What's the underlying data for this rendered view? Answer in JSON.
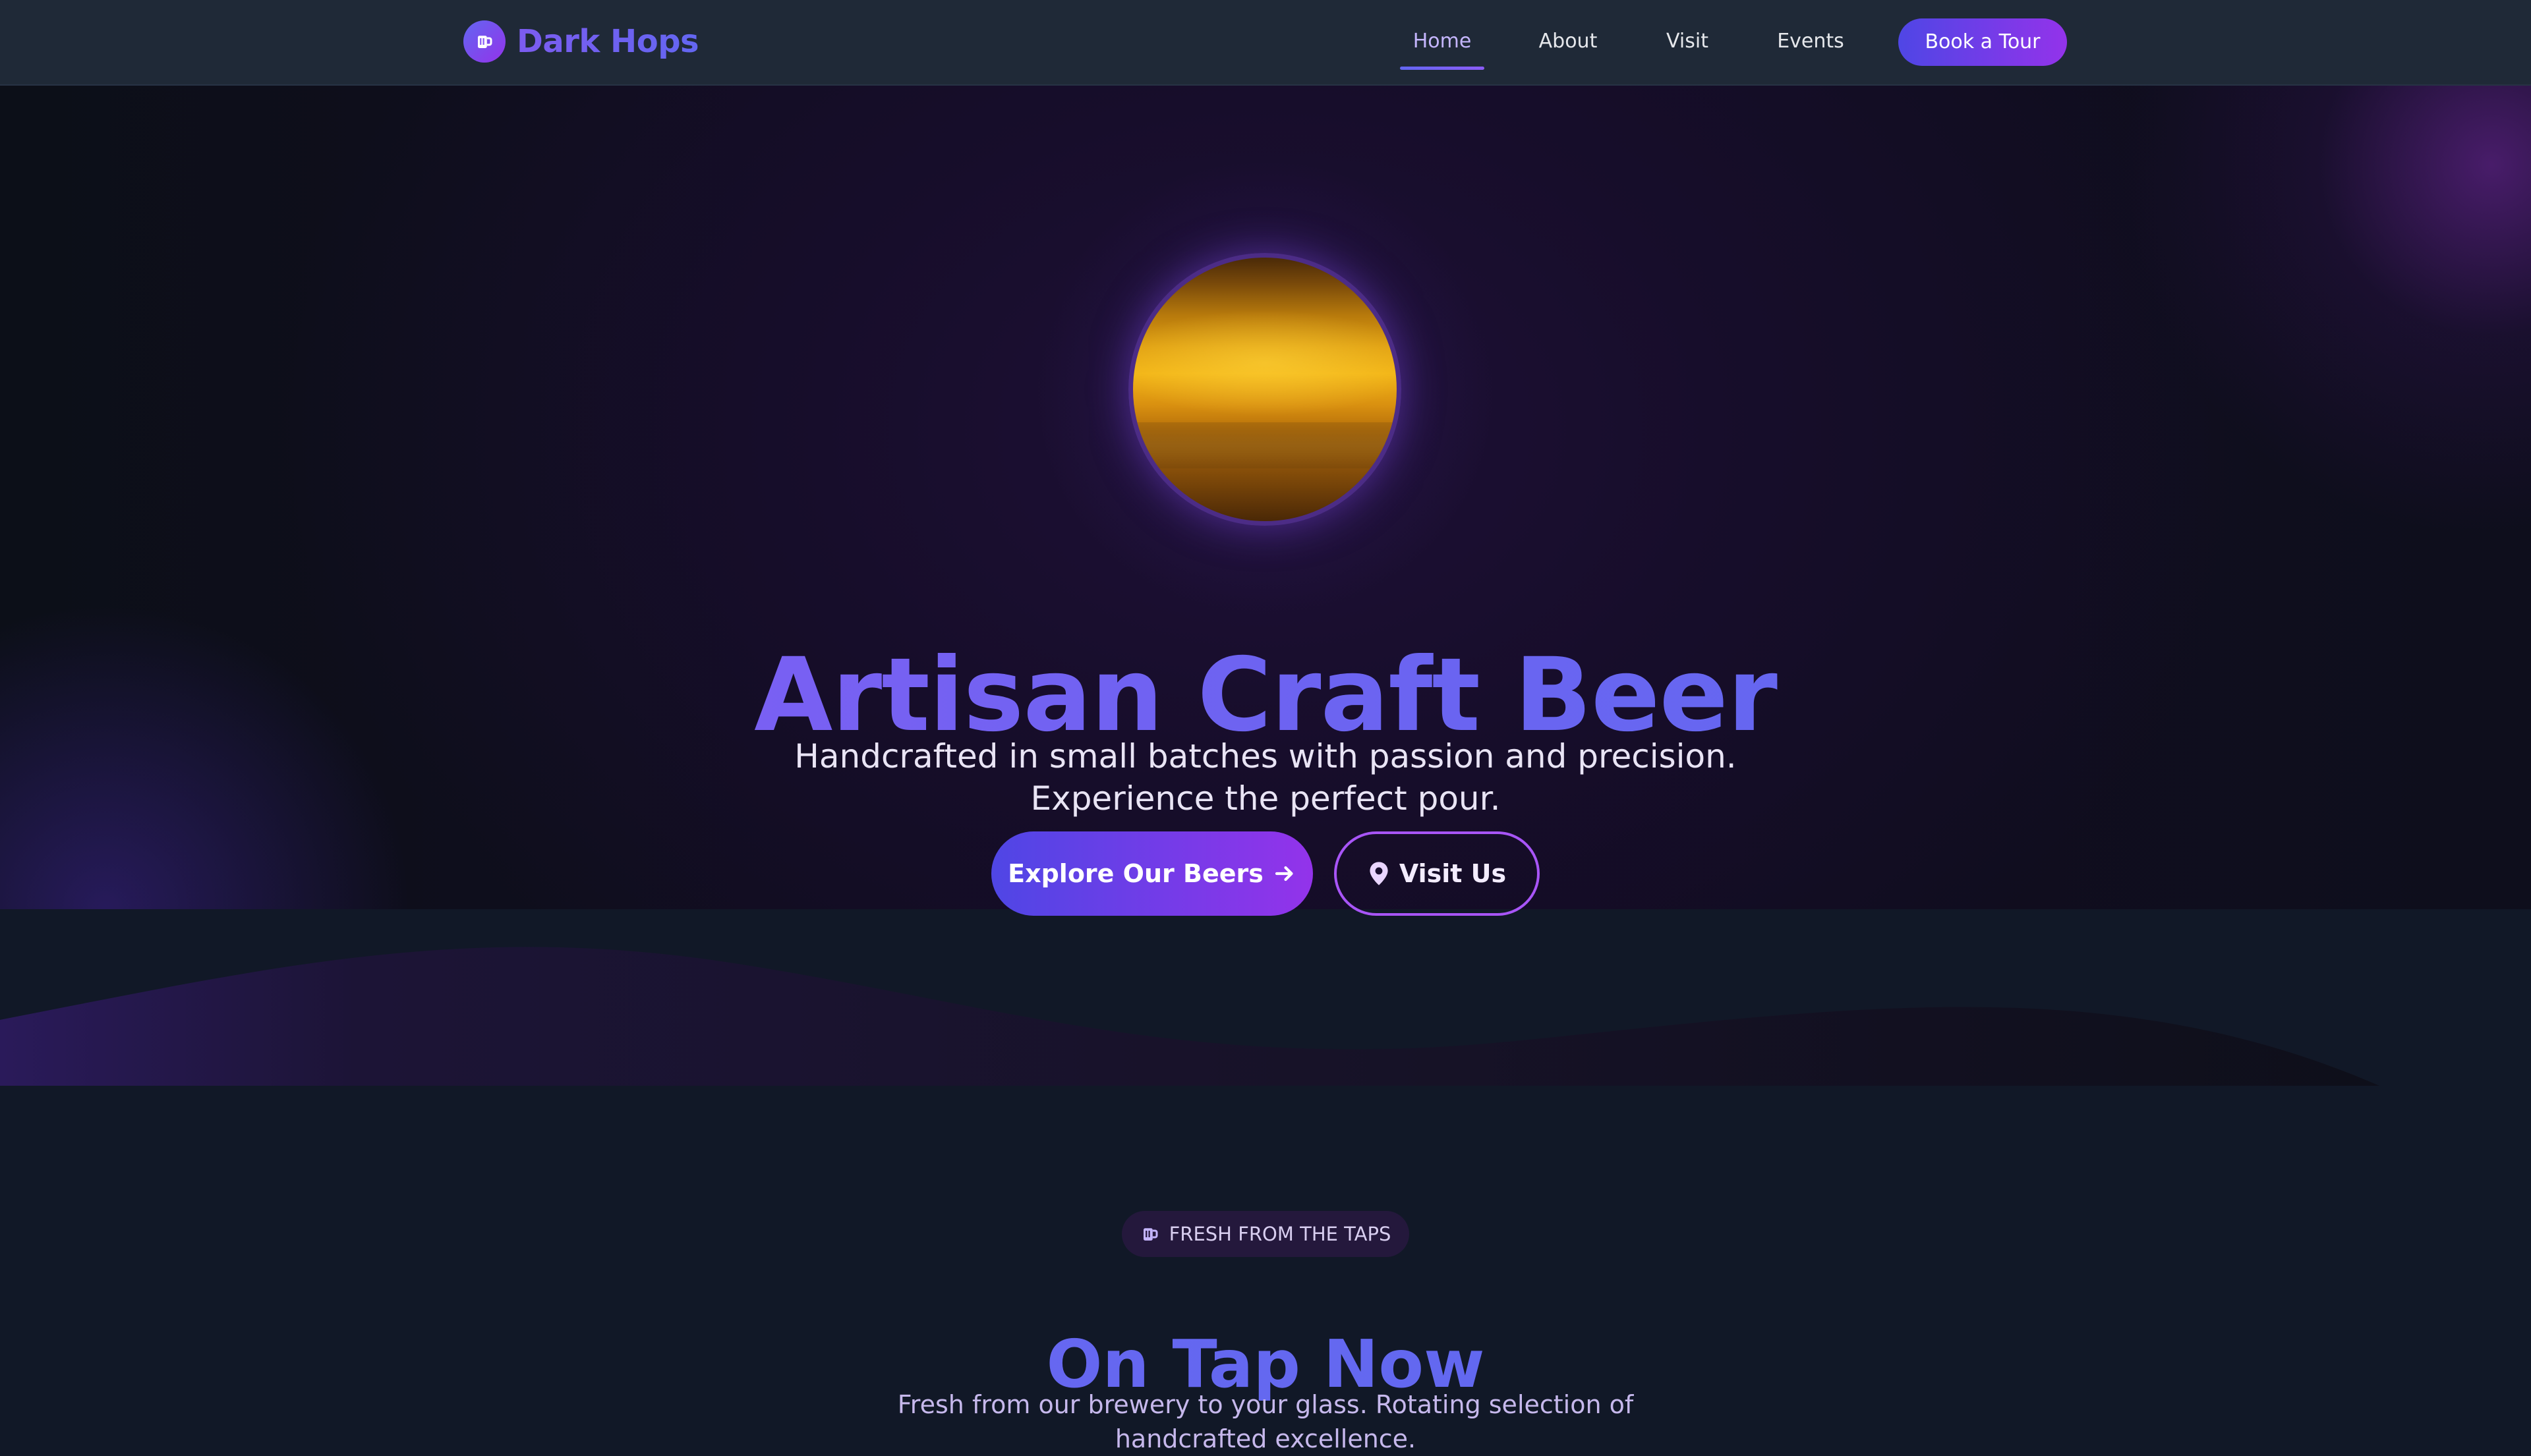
{
  "nav": {
    "brand": "Dark Hops",
    "brand_icon": "beer-mug-icon",
    "links": [
      {
        "label": "Home",
        "active": true
      },
      {
        "label": "About",
        "active": false
      },
      {
        "label": "Visit",
        "active": false
      },
      {
        "label": "Events",
        "active": false
      }
    ],
    "cta_label": "Book a Tour"
  },
  "hero": {
    "image_icon": "beer-glass-photo",
    "title": "Artisan Craft Beer",
    "subtitle": "Handcrafted in small batches with passion and precision. Experience the perfect pour.",
    "primary_button": {
      "label": "Explore Our Beers",
      "icon": "arrow-right-icon"
    },
    "secondary_button": {
      "label": "Visit Us",
      "icon": "map-pin-icon"
    }
  },
  "on_tap": {
    "badge_label": "FRESH FROM THE TAPS",
    "badge_icon": "beer-mug-icon",
    "title": "On Tap Now",
    "subtitle": "Fresh from our brewery to your glass. Rotating selection of handcrafted excellence."
  },
  "colors": {
    "accent_indigo": "#6366f1",
    "accent_purple": "#9333ea",
    "nav_bg": "#1f2937",
    "page_bg": "#111827"
  }
}
